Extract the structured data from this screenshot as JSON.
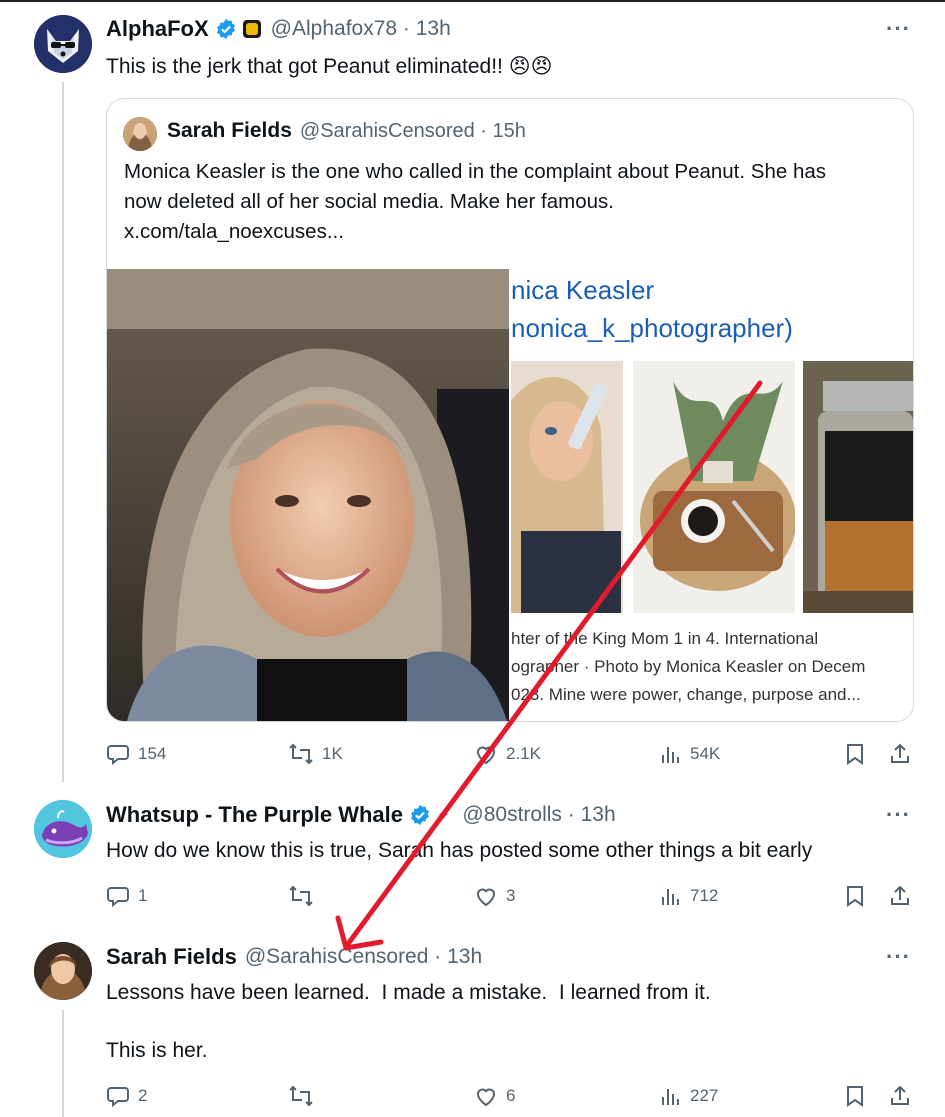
{
  "tweets": [
    {
      "name": "AlphaFoX",
      "handle": "@Alphafox78 · 13h",
      "text": "This is the jerk that got Peanut eliminated!! 😠😠",
      "actions": {
        "replies": "154",
        "reposts": "1K",
        "likes": "2.1K",
        "views": "54K"
      }
    },
    {
      "name": "Whatsup - The Purple Whale",
      "handle": "@80strolls · 13h",
      "text": "How do we know this is true, Sarah has posted some other things a bit early",
      "actions": {
        "replies": "1",
        "reposts": "",
        "likes": "3",
        "views": "712"
      }
    },
    {
      "name": "Sarah Fields",
      "handle": "@SarahisCensored · 13h",
      "text1": "Lessons have been learned.  I made a mistake.  I learned from it.",
      "text2": "This is her.",
      "actions": {
        "replies": "2",
        "reposts": "",
        "likes": "6",
        "views": "227"
      }
    }
  ],
  "quote": {
    "name": "Sarah Fields",
    "handle": "@SarahisCensored · 15h",
    "line1": "Monica Keasler is the one who called in the complaint about Peanut. She has",
    "line2": "now deleted all of her social media. Make her famous.",
    "link": "x.com/tala_noexcuses...",
    "preview": {
      "title1": "nica Keasler",
      "title2": "nonica_k_photographer)",
      "caption1": "hter of the King Mom 1 in 4. International",
      "caption2": "ographer · Photo by Monica Keasler on Decem",
      "caption3": "023. Mine were power, change, purpose and..."
    }
  },
  "more_label": "···",
  "colors": {
    "verified": "#1d9bf0",
    "arrow": "#e21b2c",
    "muted": "#536471"
  }
}
